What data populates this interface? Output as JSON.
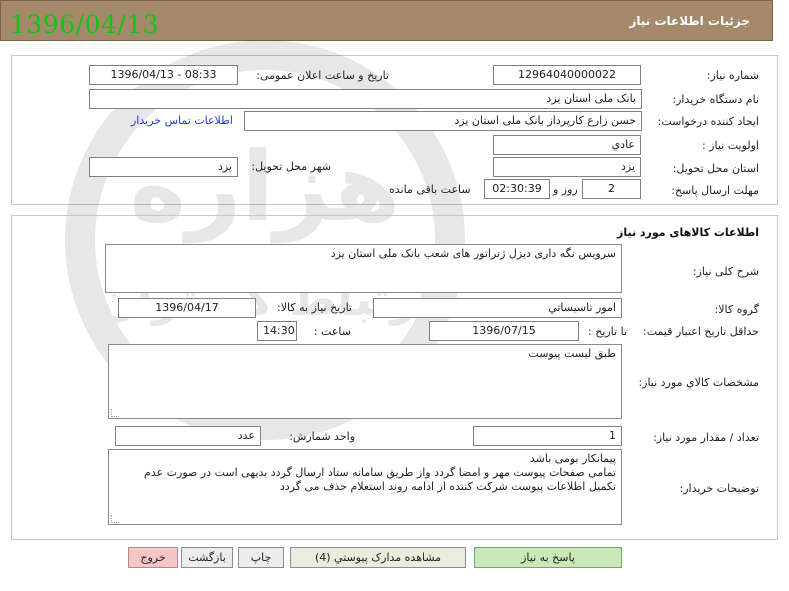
{
  "window": {
    "title": "جزئیات اطلاعات نیاز"
  },
  "stamp_date": "1396/04/13",
  "need": {
    "number_label": "شماره نیاز:",
    "number_value": "12964040000022",
    "announce_label": "تاریخ و ساعت اعلان عمومی:",
    "announce_value": "1396/04/13 - 08:33",
    "buyer_label": "نام دستگاه خریدار:",
    "buyer_value": "بانک ملی استان یزد",
    "requester_label": "ایجاد کننده درخواست:",
    "requester_value": "حسن زارع کارپرداز بانک ملی استان یزد",
    "contact_link": "اطلاعات تماس خریدار",
    "priority_label": "اولویت نیاز :",
    "priority_value": "عادي",
    "province_label": "استان محل تحویل:",
    "province_value": "یزد",
    "city_label": "شهر محل تحویل:",
    "city_value": "یزد",
    "deadline_label": "مهلت ارسال پاسخ:",
    "days_value": "2",
    "days_unit": "روز و",
    "time_value": "02:30:39",
    "remaining_label": "ساعت باقی مانده"
  },
  "goods": {
    "section_title": "اطلاعات کالاهای مورد نیاز",
    "desc_label": "شرح کلی نیاز:",
    "desc_value": "سرویس نگه داری دیزل ژنراتور های شعب بانک ملی استان یزد",
    "group_label": "گروه کالا:",
    "group_value": "امور تاسیساتي",
    "need_date_label": "تاریخ نیاز به کالا:",
    "need_date_value": "1396/04/17",
    "min_validity_label": "حداقل تاریخ اعتبار قیمت:",
    "to_date_label": "تا تاریخ :",
    "to_date_value": "1396/07/15",
    "time_label": "ساعت :",
    "time_value": "14:30",
    "spec_label": "مشخصات کالاي مورد نیاز:",
    "spec_value": "طبق لیست پیوست",
    "qty_label": "تعداد / مقدار مورد نیاز:",
    "qty_value": "1",
    "unit_label": "واحد شمارش:",
    "unit_value": "عدد",
    "buyer_notes_label": "توضیحات خریدار:",
    "buyer_notes_line1": "پیمانکار بومی باشد",
    "buyer_notes_line2": "تمامی صفحات پیوست مهر و امضا گردد واز طریق سامانه ستاد ارسال گردد بدیهی است در صورت عدم",
    "buyer_notes_line3": "تکمیل اطلاعات پیوست شرکت کننده از ادامه روند استعلام حذف می گردد"
  },
  "buttons": {
    "reply": "پاسخ به نیاز",
    "attachments": "مشاهده مدارک پیوستي (4)",
    "print": "چاپ",
    "back": "بازگشت",
    "exit": "خروج"
  },
  "colors": {
    "title_bar": "#a5896b",
    "stamp_date": "#14c414",
    "link": "#1a3ec9",
    "reply_button": "#c9e9b9",
    "exit_button": "#f4c6c6"
  },
  "watermark": {
    "text_main": "هزاره",
    "text_sub": "ارتباط گستران"
  }
}
